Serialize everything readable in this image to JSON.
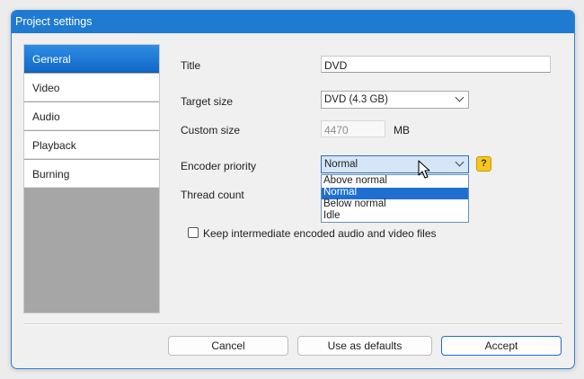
{
  "window": {
    "title": "Project settings"
  },
  "sidebar": {
    "items": [
      {
        "label": "General",
        "active": true
      },
      {
        "label": "Video",
        "active": false
      },
      {
        "label": "Audio",
        "active": false
      },
      {
        "label": "Playback",
        "active": false
      },
      {
        "label": "Burning",
        "active": false
      }
    ]
  },
  "general": {
    "title_label": "Title",
    "title_value": "DVD",
    "target_size_label": "Target size",
    "target_size_value": "DVD (4.3 GB)",
    "custom_size_label": "Custom size",
    "custom_size_value": "4470",
    "custom_size_unit": "MB",
    "encoder_priority_label": "Encoder priority",
    "encoder_priority_value": "Normal",
    "encoder_priority_options": [
      "Above normal",
      "Normal",
      "Below normal",
      "Idle"
    ],
    "encoder_priority_selected_index": 1,
    "help_icon_glyph": "?",
    "thread_count_label": "Thread count",
    "keep_files_label": "Keep intermediate encoded audio and video files",
    "keep_files_checked": false
  },
  "buttons": {
    "cancel": "Cancel",
    "defaults": "Use as defaults",
    "accept": "Accept"
  },
  "colors": {
    "title_bar": "#1f7ad1",
    "active_item": "#1a72cf",
    "help_icon": "#f7c71c",
    "selection": "#1f6fd1"
  },
  "icons": {
    "chevron": "chevron-down-icon",
    "help": "question-mark-icon",
    "cursor": "mouse-pointer-icon"
  }
}
